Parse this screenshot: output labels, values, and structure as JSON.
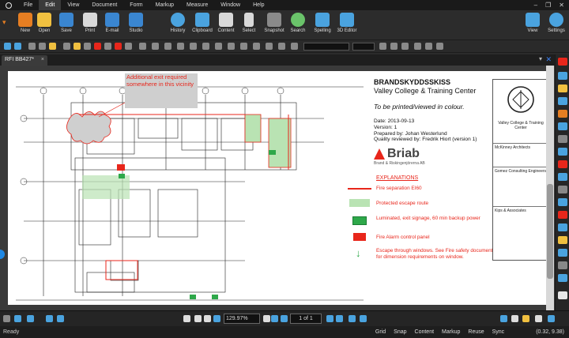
{
  "menubar": {
    "items": [
      "File",
      "Edit",
      "View",
      "Document",
      "Form",
      "Markup",
      "Measure",
      "Window",
      "Help"
    ],
    "active": "Edit",
    "window_controls": [
      "–",
      "❐",
      "✕"
    ]
  },
  "ribbon": {
    "buttons": [
      {
        "label": "New",
        "icon": "new-doc-icon",
        "color": "#e67e22"
      },
      {
        "label": "Open",
        "icon": "folder-icon",
        "color": "#f0c040"
      },
      {
        "label": "Save",
        "icon": "save-icon",
        "color": "#3a86d1"
      },
      {
        "label": "Print",
        "icon": "printer-icon",
        "color": "#d9d9d9"
      },
      {
        "label": "E-mail",
        "icon": "email-icon",
        "color": "#3a86d1"
      },
      {
        "label": "Studio",
        "icon": "studio-icon",
        "color": "#3a86d1"
      },
      {
        "label": "History",
        "icon": "history-icon",
        "color": "#4aa3df"
      },
      {
        "label": "Clipboard",
        "icon": "clipboard-icon",
        "color": "#4aa3df"
      },
      {
        "label": "Content",
        "icon": "content-icon",
        "color": "#d9d9d9"
      },
      {
        "label": "Select",
        "icon": "cursor-icon",
        "color": "#d9d9d9"
      },
      {
        "label": "Snapshot",
        "icon": "snapshot-icon",
        "color": "#8a8a8a"
      },
      {
        "label": "Search",
        "icon": "search-icon",
        "color": "#6ac36a"
      },
      {
        "label": "Spelling",
        "icon": "spelling-icon",
        "color": "#4aa3df"
      },
      {
        "label": "3D Editor",
        "icon": "cube-icon",
        "color": "#4aa3df"
      }
    ],
    "right_buttons": [
      {
        "label": "View",
        "icon": "monitor-icon",
        "color": "#4aa3df"
      },
      {
        "label": "Settings",
        "icon": "gear-icon",
        "color": "#4aa3df"
      }
    ]
  },
  "doc_tab": {
    "label": "RFI BB427*",
    "close": "×"
  },
  "drawing": {
    "callout": "Additional exit required somewhere in this vicinity",
    "header_main": "BRANDSKYDDSSKISS",
    "header_sub": "Valley College & Training Center",
    "print_note": "To be printed/viewed in colour.",
    "meta": [
      "Date: 2013-09-13",
      "Version: 1",
      "Prepared by: Johan Westerlund",
      "Quality reviewed by: Fredrik Hiort (version 1)"
    ],
    "brand": "Briab",
    "brand_tagline": "Brand & Riskingenjörerna AB",
    "explanations_title": "EXPLANATIONS",
    "legend": [
      {
        "text": "Fire separation EI60",
        "mark": "line"
      },
      {
        "text": "Protected escape route",
        "mark": "green-box"
      },
      {
        "text": "Luminated, exit signage, 60 min backup power",
        "mark": "exit-sign"
      },
      {
        "text": "Fire Alarm control panel",
        "mark": "alarm-panel"
      },
      {
        "text": "Escape through windows. See Fire safety document for dimension requirements on window.",
        "mark": "arrow"
      }
    ],
    "titleblock": {
      "client": "Valley College & Training Center",
      "architect": "McKinney Architects",
      "engineer": "Gomez Consulting Engineers",
      "associates": "Kips & Associates"
    }
  },
  "navbar": {
    "zoom": "129.97%",
    "page": "1 of 1"
  },
  "status": {
    "ready": "Ready",
    "toggles": [
      "Grid",
      "Snap",
      "Content",
      "Markup",
      "Reuse",
      "Sync"
    ],
    "coords": "(0.32, 9.38)"
  }
}
